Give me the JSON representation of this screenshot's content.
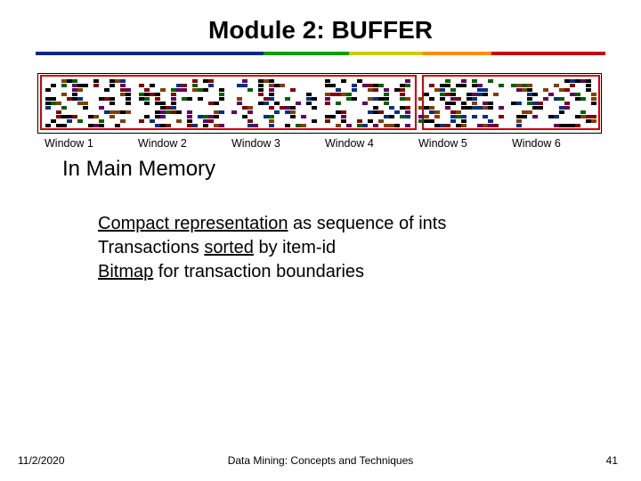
{
  "title_part1": "Module 2: ",
  "title_part2": "BUFFER",
  "windows": [
    {
      "label": "Window 1"
    },
    {
      "label": "Window 2"
    },
    {
      "label": "Window 3"
    },
    {
      "label": "Window 4"
    },
    {
      "label": "Window 5"
    },
    {
      "label": "Window 6"
    }
  ],
  "subheading": "In Main Memory",
  "body": {
    "line1a": "Compact representation",
    "line1b": " as sequence of ints",
    "line2a": "Transactions ",
    "line2b": "sorted",
    "line2c": " by item-id",
    "line3a": "Bitmap",
    "line3b": " for transaction boundaries"
  },
  "footer": {
    "date": "11/2/2020",
    "course": "Data Mining: Concepts and Techniques",
    "page": "41"
  }
}
